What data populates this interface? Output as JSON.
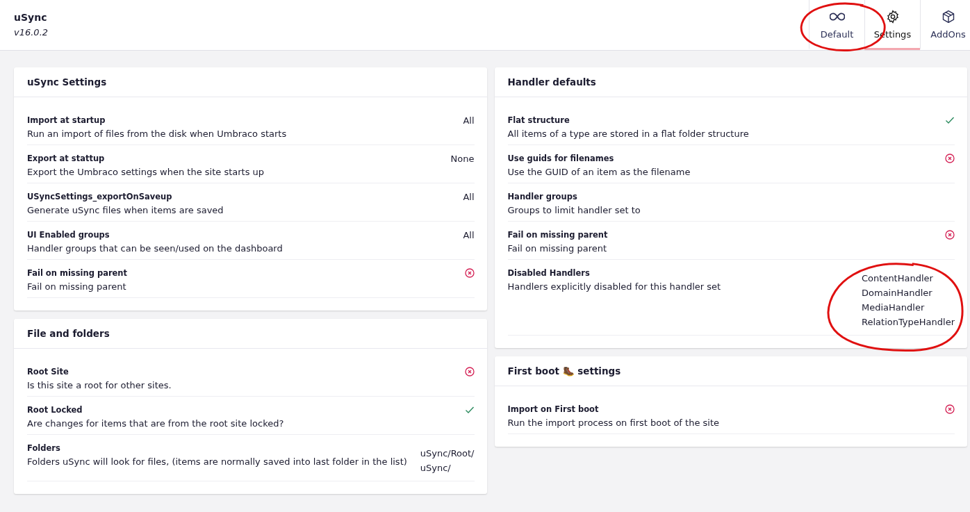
{
  "header": {
    "title": "uSync",
    "version": "v16.0.2"
  },
  "tabs": [
    {
      "label": "Default",
      "selected": false
    },
    {
      "label": "Settings",
      "selected": true
    },
    {
      "label": "AddOns",
      "selected": false
    }
  ],
  "columns": [
    [
      {
        "title": "uSync Settings",
        "rows": [
          {
            "name": "Import at startup",
            "description": "Run an import of files from the disk when Umbraco starts",
            "kind": "text",
            "value": "All"
          },
          {
            "name": "Export at stattup",
            "description": "Export the Umbraco settings when the site starts up",
            "kind": "text",
            "value": "None"
          },
          {
            "name": "USyncSettings_exportOnSaveup",
            "description": "Generate uSync files when items are saved",
            "kind": "text",
            "value": "All"
          },
          {
            "name": "UI Enabled groups",
            "description": "Handler groups that can be seen/used on the dashboard",
            "kind": "text",
            "value": "All"
          },
          {
            "name": "Fail on missing parent",
            "description": "Fail on missing parent",
            "kind": "bool",
            "on": false
          }
        ]
      },
      {
        "title": "File and folders",
        "rows": [
          {
            "name": "Root Site",
            "description": "Is this site a root for other sites.",
            "kind": "bool",
            "on": false
          },
          {
            "name": "Root Locked",
            "description": "Are changes for items that are from the root site locked?",
            "kind": "bool",
            "on": true
          },
          {
            "name": "Folders",
            "description": "Folders uSync will look for files, (items are normally saved into last folder in the list)",
            "kind": "list",
            "values": [
              "uSync/Root/",
              "uSync/"
            ]
          }
        ]
      }
    ],
    [
      {
        "title": "Handler defaults",
        "rows": [
          {
            "name": "Flat structure",
            "description": "All items of a type are stored in a flat folder structure",
            "kind": "bool",
            "on": true
          },
          {
            "name": "Use guids for filenames",
            "description": "Use the GUID of an item as the filename",
            "kind": "bool",
            "on": false
          },
          {
            "name": "Handler groups",
            "description": "Groups to limit handler set to",
            "kind": "list",
            "values": []
          },
          {
            "name": "Fail on missing parent",
            "description": "Fail on missing parent",
            "kind": "bool",
            "on": false
          },
          {
            "name": "Disabled Handlers",
            "description": "Handlers explicitly disabled for this handler set",
            "kind": "list",
            "values": [
              "ContentHandler",
              "DomainHandler",
              "MediaHandler",
              "RelationTypeHandler"
            ]
          }
        ]
      },
      {
        "title": "First boot 🥾 settings",
        "rows": [
          {
            "name": "Import on First boot",
            "description": "Run the import process on first boot of the site",
            "kind": "bool",
            "on": false
          }
        ]
      }
    ]
  ]
}
